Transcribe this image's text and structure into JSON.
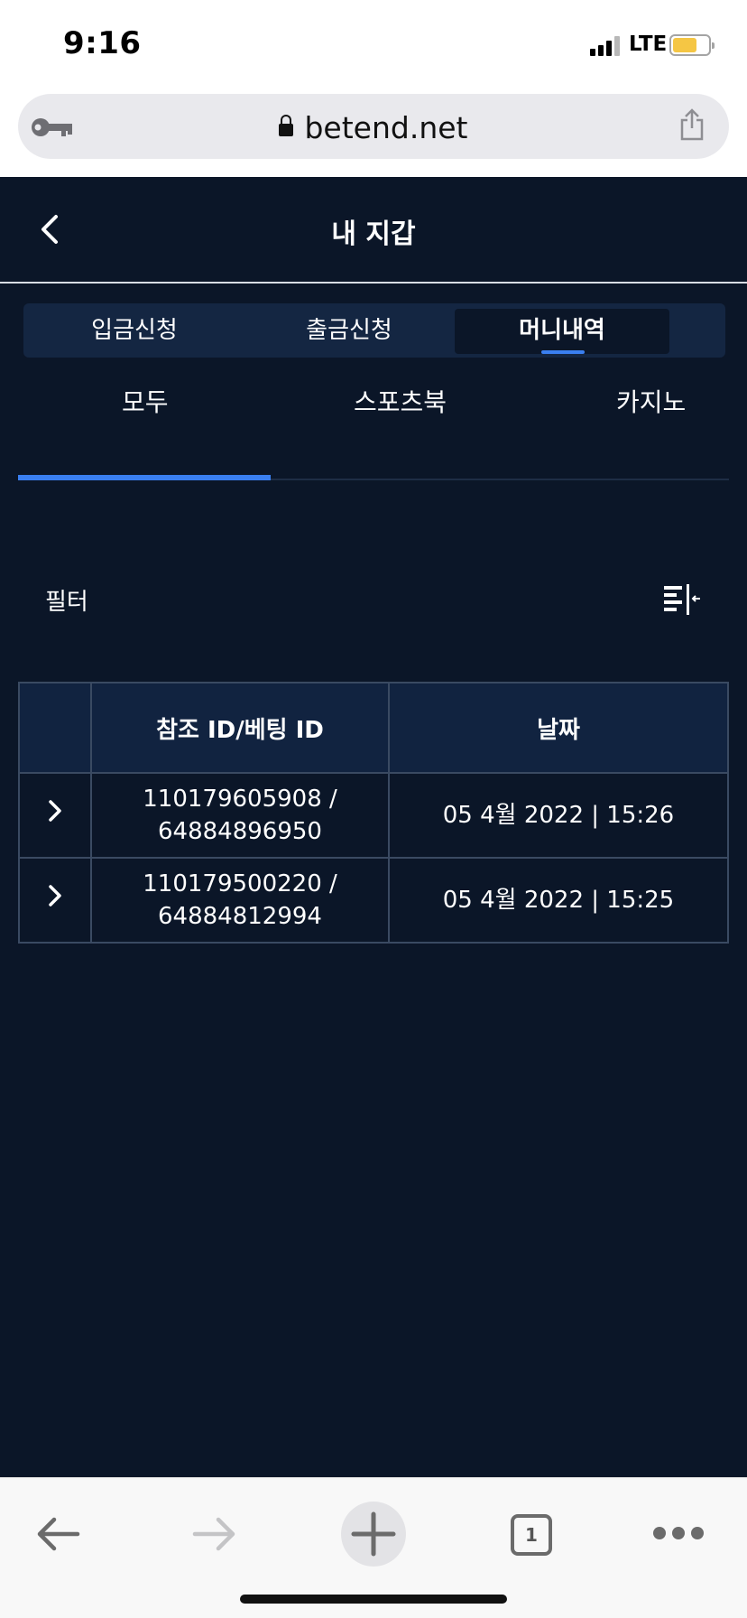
{
  "status_bar": {
    "time": "9:16",
    "network": "LTE"
  },
  "browser": {
    "url": "betend.net",
    "tab_count": "1"
  },
  "header": {
    "title": "내 지갑"
  },
  "segments": [
    "입금신청",
    "출금신청",
    "머니내역"
  ],
  "subtabs": [
    "모두",
    "스포츠북",
    "카지노"
  ],
  "filter": {
    "label": "필터"
  },
  "table": {
    "headers": [
      "참조 ID/베팅 ID",
      "날짜"
    ],
    "rows": [
      {
        "ref_id": "110179605908 /",
        "bet_id": "64884896950",
        "date": "05 4월 2022 | 15:26"
      },
      {
        "ref_id": "110179500220 /",
        "bet_id": "64884812994",
        "date": "05 4월 2022 | 15:25"
      }
    ]
  },
  "colors": {
    "background": "#0b1628",
    "panel": "#142642",
    "accent": "#3a7ff0",
    "battery": "#f5c644"
  }
}
